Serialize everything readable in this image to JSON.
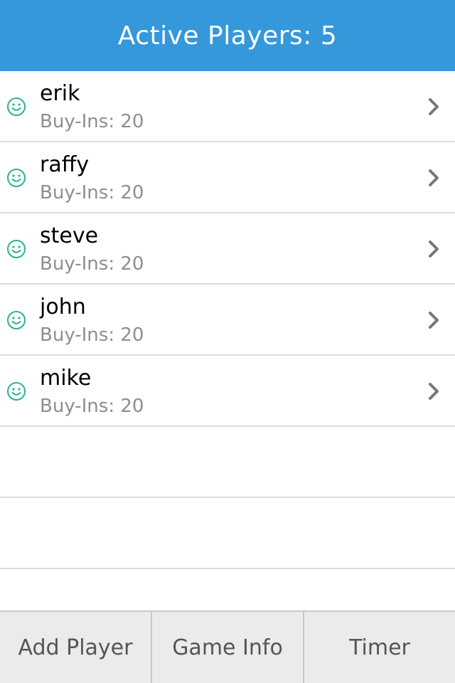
{
  "header": {
    "title": "Active Players: 5"
  },
  "players": [
    {
      "name": "erik",
      "buyins": "Buy-Ins: 20",
      "icon": "smiley-icon"
    },
    {
      "name": "raffy",
      "buyins": "Buy-Ins: 20",
      "icon": "smiley-icon"
    },
    {
      "name": "steve",
      "buyins": "Buy-Ins: 20",
      "icon": "smiley-icon"
    },
    {
      "name": "john",
      "buyins": "Buy-Ins: 20",
      "icon": "smiley-icon"
    },
    {
      "name": "mike",
      "buyins": "Buy-Ins: 20",
      "icon": "smiley-icon"
    }
  ],
  "tabs": [
    {
      "label": "Add Player"
    },
    {
      "label": "Game Info"
    },
    {
      "label": "Timer"
    }
  ],
  "colors": {
    "header_bg": "#3498db",
    "smiley": "#2bb58a",
    "chevron": "#777777",
    "secondary_text": "#8e8e93",
    "tabbar_bg": "#e9eceb"
  }
}
